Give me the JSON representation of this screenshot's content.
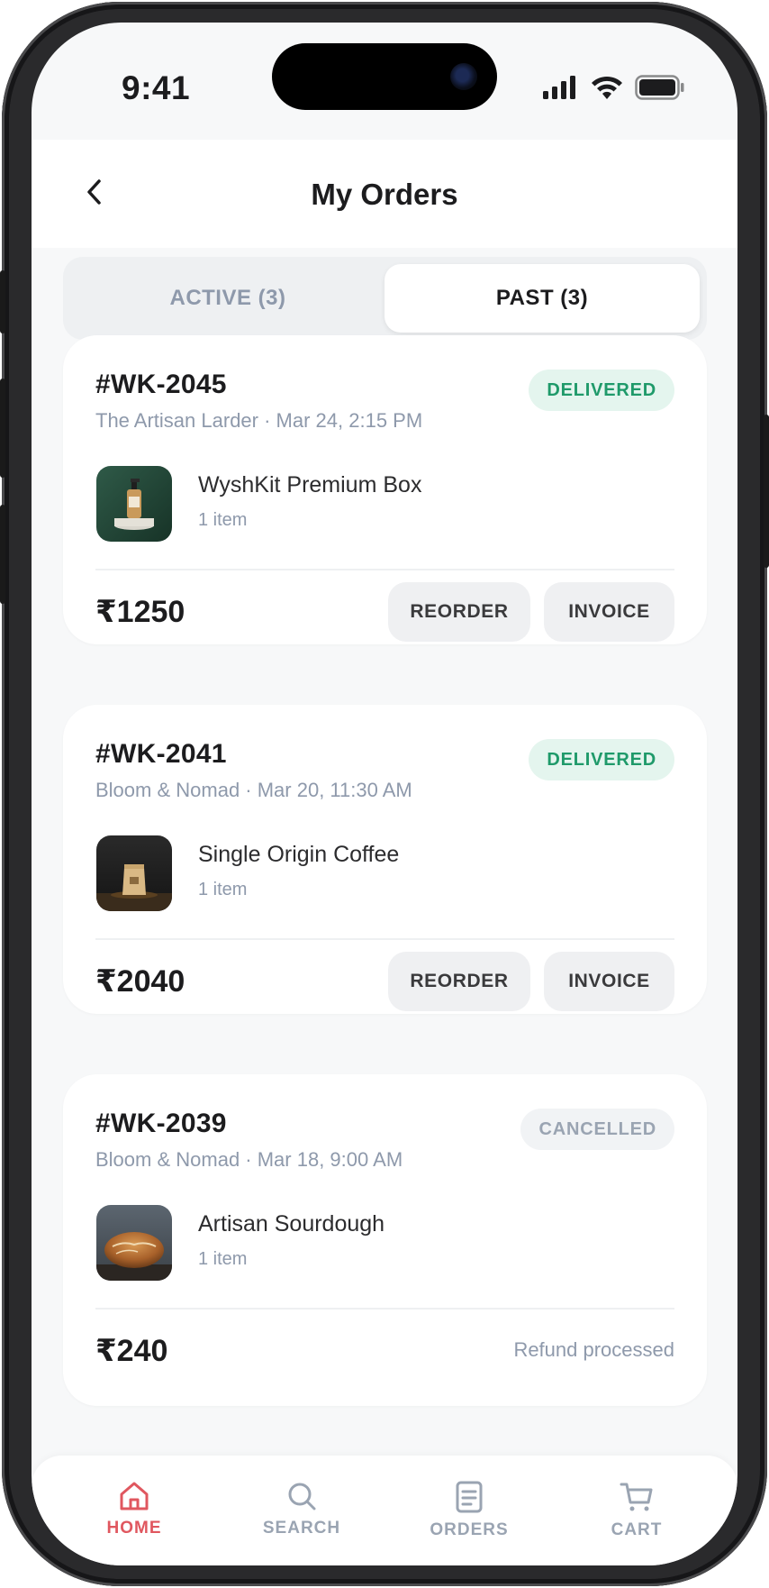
{
  "status_bar": {
    "time": "9:41"
  },
  "header": {
    "title": "My Orders"
  },
  "tabs": [
    {
      "label": "ACTIVE (3)",
      "active": false
    },
    {
      "label": "PAST (3)",
      "active": true
    }
  ],
  "orders": [
    {
      "id": "#WK-2045",
      "meta": "The Artisan Larder · Mar 24, 2:15 PM",
      "status": "DELIVERED",
      "item_name": "WyshKit Premium Box",
      "item_qty": "1 item",
      "price": "₹1250",
      "actions": [
        "REORDER",
        "INVOICE"
      ],
      "thumb_icon": "skincare-bottle-image"
    },
    {
      "id": "#WK-2041",
      "meta": "Bloom & Nomad · Mar 20, 11:30 AM",
      "status": "DELIVERED",
      "item_name": "Single Origin Coffee",
      "item_qty": "1 item",
      "price": "₹2040",
      "actions": [
        "REORDER",
        "INVOICE"
      ],
      "thumb_icon": "coffee-bag-image"
    },
    {
      "id": "#WK-2039",
      "meta": "Bloom & Nomad · Mar 18, 9:00 AM",
      "status": "CANCELLED",
      "item_name": "Artisan Sourdough",
      "item_qty": "1 item",
      "price": "₹240",
      "note": "Refund processed",
      "thumb_icon": "bread-loaf-image"
    }
  ],
  "bottom_nav": [
    {
      "label": "HOME",
      "icon": "home-icon",
      "active": true
    },
    {
      "label": "SEARCH",
      "icon": "search-icon",
      "active": false
    },
    {
      "label": "ORDERS",
      "icon": "orders-icon",
      "active": false
    },
    {
      "label": "CART",
      "icon": "cart-icon",
      "active": false
    }
  ],
  "colors": {
    "accent": "#e0575f",
    "delivered_text": "#1f9a6a",
    "delivered_bg": "#e4f5ee",
    "muted": "#8e99ab"
  }
}
